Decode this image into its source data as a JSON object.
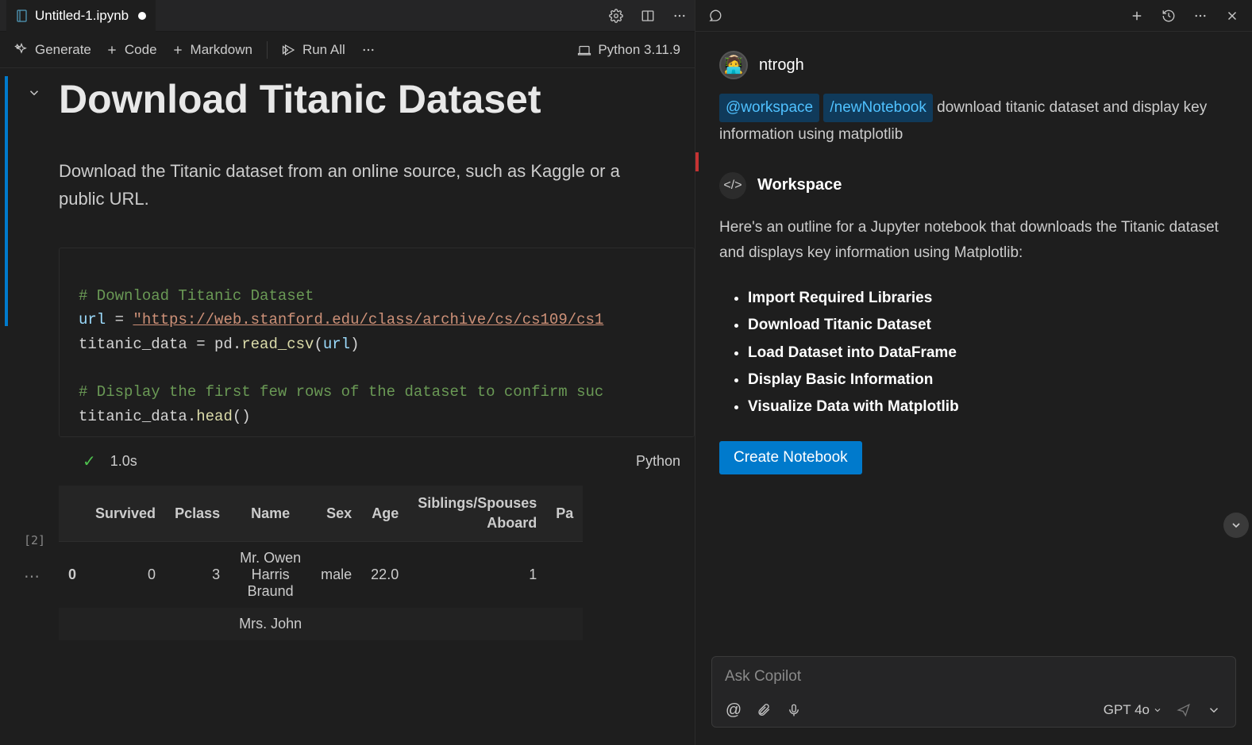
{
  "tab": {
    "title": "Untitled-1.ipynb"
  },
  "toolbar": {
    "generate": "Generate",
    "code": "Code",
    "markdown": "Markdown",
    "runall": "Run All",
    "kernel": "Python 3.11.9"
  },
  "markdown": {
    "h1": "Download Titanic Dataset",
    "p": "Download the Titanic dataset from an online source, such as Kaggle or a public URL."
  },
  "code": {
    "c1": "# Download Titanic Dataset",
    "l2a": "url",
    "l2b": " = ",
    "l2c": "\"https://web.stanford.edu/class/archive/cs/cs109/cs1",
    "l3a": "titanic_data = pd.",
    "l3f": "read_csv",
    "l3p1": "(",
    "l3v": "url",
    "l3p2": ")",
    "c5": "# Display the first few rows of the dataset to confirm suc",
    "l6a": "titanic_data.",
    "l6f": "head",
    "l6p": "()"
  },
  "exec": {
    "label": "[2]",
    "time": "1.0s",
    "lang": "Python"
  },
  "table": {
    "headers": [
      "Survived",
      "Pclass",
      "Name",
      "Sex",
      "Age",
      "Siblings/Spouses\nAboard",
      "Pa"
    ],
    "row0": {
      "idx": "0",
      "survived": "0",
      "pclass": "3",
      "name": "Mr. Owen\nHarris\nBraund",
      "sex": "male",
      "age": "22.0",
      "sib": "1"
    },
    "row1": {
      "name": "Mrs. John"
    }
  },
  "chat": {
    "username": "ntrogh",
    "chip1": "@workspace",
    "chip2": "/newNotebook",
    "usermsg": "download titanic dataset and display key information using matplotlib",
    "ws_label": "Workspace",
    "ws_text": "Here's an outline for a Jupyter notebook that downloads the Titanic dataset and displays key information using Matplotlib:",
    "items": [
      "Import Required Libraries",
      "Download Titanic Dataset",
      "Load Dataset into DataFrame",
      "Display Basic Information",
      "Visualize Data with Matplotlib"
    ],
    "create_btn": "Create Notebook",
    "placeholder": "Ask Copilot",
    "model": "GPT 4o"
  }
}
